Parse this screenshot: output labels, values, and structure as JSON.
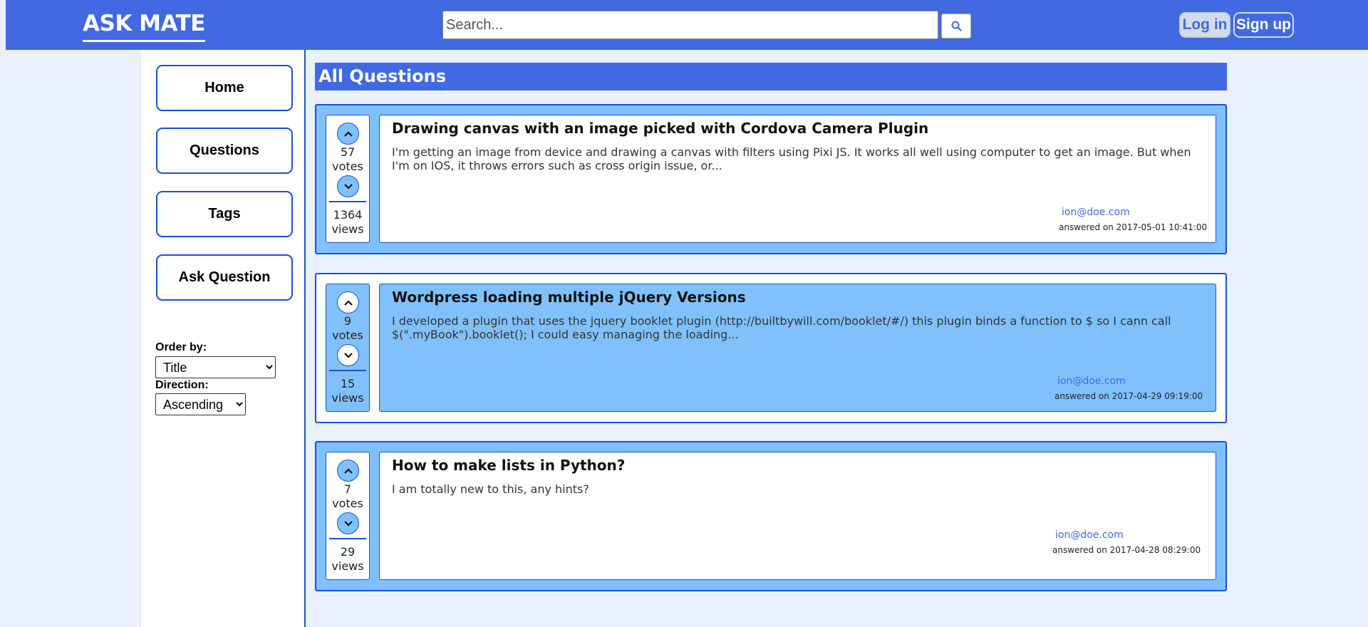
{
  "header": {
    "logo": "ASK MATE",
    "search_placeholder": "Search...",
    "login_label": "Log in",
    "signup_label": "Sign up"
  },
  "sidebar": {
    "nav": [
      {
        "label": "Home"
      },
      {
        "label": "Questions"
      },
      {
        "label": "Tags"
      },
      {
        "label": "Ask Question"
      }
    ],
    "order_by_label": "Order by:",
    "order_by_value": "Title",
    "direction_label": "Direction:",
    "direction_value": "Ascending"
  },
  "main": {
    "title": "All Questions",
    "questions": [
      {
        "votes": "57",
        "votes_label": "votes",
        "views": "1364",
        "views_label": "views",
        "title": "Drawing canvas with an image picked with Cordova Camera Plugin",
        "text": "I'm getting an image from device and drawing a canvas with filters using Pixi JS. It works all well using computer to get an image. But when I'm on IOS, it throws errors such as cross origin issue, or...",
        "author": "ion@doe.com",
        "answered": "answered on 2017-05-01 10:41:00"
      },
      {
        "votes": "9",
        "votes_label": "votes",
        "views": "15",
        "views_label": "views",
        "title": "Wordpress loading multiple jQuery Versions",
        "text": "I developed a plugin that uses the jquery booklet plugin (http://builtbywill.com/booklet/#/) this plugin binds a function to $ so I cann call $(\".myBook\").booklet(); I could easy managing the loading...",
        "author": "ion@doe.com",
        "answered": "answered on 2017-04-29 09:19:00"
      },
      {
        "votes": "7",
        "votes_label": "votes",
        "views": "29",
        "views_label": "views",
        "title": "How to make lists in Python?",
        "text": "I am totally new to this, any hints?",
        "author": "ion@doe.com",
        "answered": "answered on 2017-04-28 08:29:00"
      }
    ]
  },
  "colors": {
    "brand": "#4169e1",
    "card_light_blue": "#80c1fd",
    "border_blue": "#1a4fd6",
    "page_bg": "#eaf1fd"
  }
}
